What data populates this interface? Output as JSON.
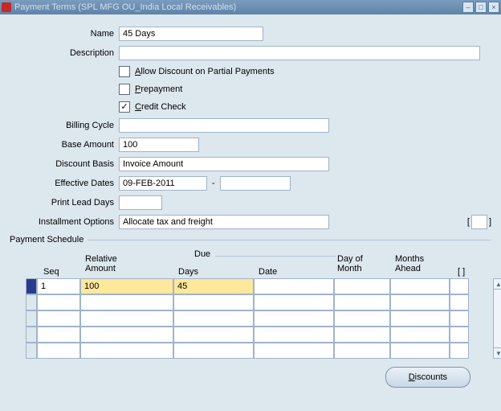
{
  "window": {
    "title": "Payment Terms (SPL MFG OU_India Local Receivables)"
  },
  "labels": {
    "name": "Name",
    "description": "Description",
    "billing_cycle": "Billing Cycle",
    "base_amount": "Base Amount",
    "discount_basis": "Discount Basis",
    "effective_dates": "Effective Dates",
    "print_lead_days": "Print Lead Days",
    "installment_options": "Installment Options",
    "section": "Payment Schedule",
    "dash": "-"
  },
  "fields": {
    "name": "45 Days",
    "description": "",
    "billing_cycle": "",
    "base_amount": "100",
    "discount_basis": "Invoice Amount",
    "effective_from": "09-FEB-2011",
    "effective_to": "",
    "print_lead_days": "",
    "installment_options": "Allocate tax and freight"
  },
  "checks": {
    "allow_html": "<span class='ul'>A</span>llow Discount on Partial Payments",
    "prepay_html": "<span class='ul'>P</span>repayment",
    "credit_html": "<span class='ul'>C</span>redit Check"
  },
  "cols": {
    "seq": "Seq",
    "relative_amount": "Relative\nAmount",
    "due": "Due",
    "days": "Days",
    "date": "Date",
    "day_of_month": "Day of\nMonth",
    "months_ahead": "Months\nAhead",
    "tail": "[  ]"
  },
  "rows": [
    {
      "seq": "1",
      "rel": "100",
      "days": "45",
      "date": "",
      "dom": "",
      "ma": ""
    },
    {
      "seq": "",
      "rel": "",
      "days": "",
      "date": "",
      "dom": "",
      "ma": ""
    },
    {
      "seq": "",
      "rel": "",
      "days": "",
      "date": "",
      "dom": "",
      "ma": ""
    },
    {
      "seq": "",
      "rel": "",
      "days": "",
      "date": "",
      "dom": "",
      "ma": ""
    },
    {
      "seq": "",
      "rel": "",
      "days": "",
      "date": "",
      "dom": "",
      "ma": ""
    }
  ],
  "buttons": {
    "discounts_html": "<span class='ul'>D</span>iscounts"
  }
}
